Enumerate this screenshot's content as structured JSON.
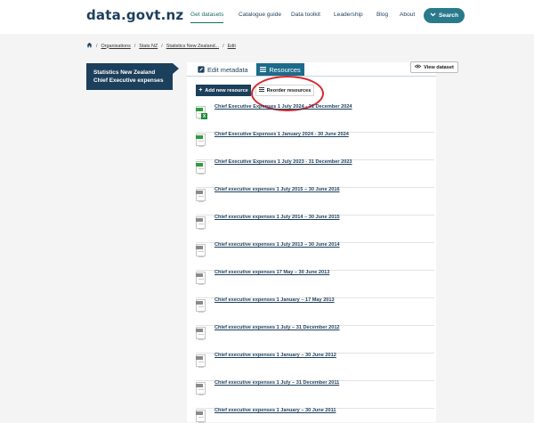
{
  "header": {
    "logo": "data.govt.nz",
    "nav": [
      {
        "label": "Get datasets",
        "active": true
      },
      {
        "label": "Catalogue guide",
        "active": false
      },
      {
        "label": "Data toolkit",
        "active": false
      },
      {
        "label": "Leadership",
        "active": false
      },
      {
        "label": "Blog",
        "active": false
      },
      {
        "label": "About",
        "active": false
      }
    ],
    "search_label": "Search"
  },
  "breadcrumb": {
    "items": [
      "Organisations",
      "Stats NZ",
      "Statistics New Zealand...",
      "Edit"
    ],
    "separator": "/"
  },
  "sidebar": {
    "title": "Statistics New Zealand Chief Executive expenses"
  },
  "tabs": {
    "edit_metadata": "Edit metadata",
    "resources": "Resources"
  },
  "actions": {
    "view_dataset": "View dataset",
    "add_resource": "Add new resource",
    "reorder_resources": "Reorder resources"
  },
  "resources": [
    {
      "title": "Chief Executive Expenses 1 July 2024 - 31 December 2024",
      "type": "xlsx"
    },
    {
      "title": "Chief Executive Expenses 1 January 2024 - 30 June 2024",
      "type": "csv"
    },
    {
      "title": "Chief Executive Expenses 1 July 2023 - 31 December 2023",
      "type": "csv"
    },
    {
      "title": "Chief executive expenses 1 July 2015 – 30 June 2016",
      "type": "file"
    },
    {
      "title": "Chief executive expenses 1 July 2014 – 30 June 2015",
      "type": "file"
    },
    {
      "title": "Chief executive expenses 1 July 2013 – 30 June 2014",
      "type": "file"
    },
    {
      "title": "Chief executive expenses 17 May – 30 June 2013",
      "type": "file"
    },
    {
      "title": "Chief executive expenses 1 January – 17 May 2013",
      "type": "file"
    },
    {
      "title": "Chief executive expenses 1 July – 31 December 2012",
      "type": "file"
    },
    {
      "title": "Chief executive expenses 1 January – 30 June 2012",
      "type": "file"
    },
    {
      "title": "Chief executive expenses 1 July – 31 December 2011",
      "type": "file"
    },
    {
      "title": "Chief executive expenses 1 January – 30 June 2011",
      "type": "file"
    }
  ],
  "colors": {
    "brand": "#1c3f5c",
    "accent": "#2a7a8c",
    "active_nav": "#1c6f5e",
    "annotation": "#d8262c"
  }
}
